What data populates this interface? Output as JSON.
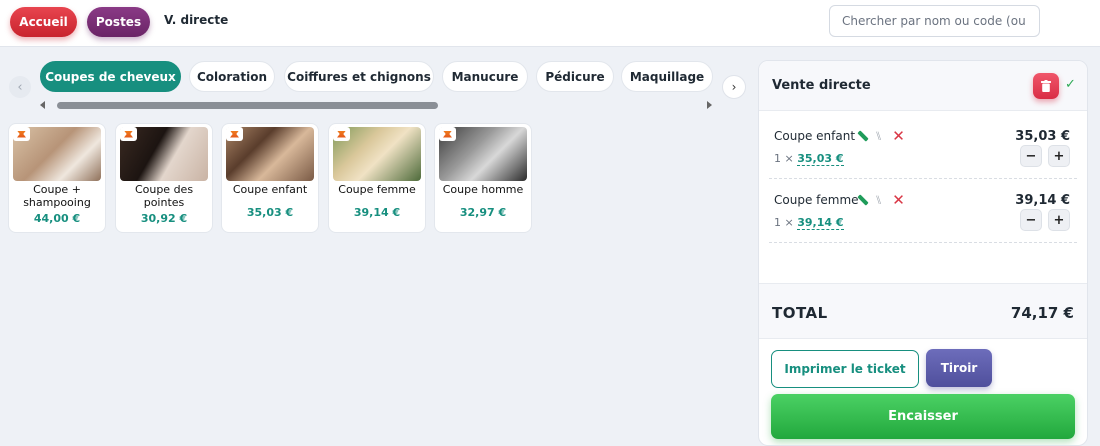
{
  "header": {
    "home_label": "Accueil",
    "posts_label": "Postes",
    "breadcrumb": "V. directe",
    "search_placeholder": "Chercher par nom ou code (ou"
  },
  "categories": {
    "prev_icon": "‹",
    "next_icon": "›",
    "items": [
      {
        "label": "Coupes de cheveux",
        "active": true
      },
      {
        "label": "Coloration",
        "active": false
      },
      {
        "label": "Coiffures et chignons",
        "active": false
      },
      {
        "label": "Manucure",
        "active": false
      },
      {
        "label": "Pédicure",
        "active": false
      },
      {
        "label": "Maquillage",
        "active": false
      }
    ]
  },
  "products": [
    {
      "name": "Coupe + shampooing",
      "price": "44,00 €",
      "image": "shampoo-photo"
    },
    {
      "name": "Coupe des pointes",
      "price": "30,92 €",
      "image": "tips-cut-photo"
    },
    {
      "name": "Coupe enfant",
      "price": "35,03 €",
      "image": "child-cut-photo"
    },
    {
      "name": "Coupe femme",
      "price": "39,14 €",
      "image": "woman-cut-photo"
    },
    {
      "name": "Coupe homme",
      "price": "32,97 €",
      "image": "man-cut-photo"
    }
  ],
  "sale": {
    "title": "Vente directe",
    "check_icon": "✓",
    "lines": [
      {
        "name": "Coupe enfant",
        "qty_prefix": "1 ×",
        "unit_price": "35,03 €",
        "total": "35,03 €"
      },
      {
        "name": "Coupe femme",
        "qty_prefix": "1 ×",
        "unit_price": "39,14 €",
        "total": "39,14 €"
      }
    ],
    "minus_label": "−",
    "plus_label": "+",
    "total_label": "TOTAL",
    "total_value": "74,17 €",
    "print_label": "Imprimer le ticket",
    "drawer_label": "Tiroir",
    "cash_label": "Encaisser"
  },
  "colors": {
    "accent": "#178f7f",
    "danger": "#d92d45",
    "success": "#22a83d",
    "drawer": "#5b5baa"
  }
}
